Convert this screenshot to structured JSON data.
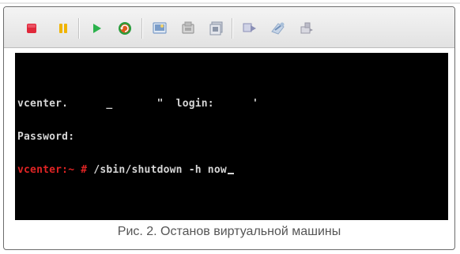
{
  "toolbar": {
    "buttons": [
      {
        "name": "power-off",
        "icon": "stop-square-icon",
        "color": "#e0283a"
      },
      {
        "name": "pause",
        "icon": "pause-icon",
        "color": "#f0b400"
      },
      {
        "name": "power-on",
        "icon": "play-icon",
        "color": "#2bb24c"
      },
      {
        "name": "reset",
        "icon": "reset-icon",
        "color": "#e05a1c"
      },
      {
        "name": "snapshot",
        "icon": "snapshot-icon",
        "color": "#7a9cc8"
      },
      {
        "name": "revert",
        "icon": "revert-icon",
        "color": "#9a9a9a"
      },
      {
        "name": "manager",
        "icon": "manager-icon",
        "color": "#8c96a8"
      },
      {
        "name": "fullscreen",
        "icon": "console-icon",
        "color": "#8a8fb6"
      },
      {
        "name": "tools",
        "icon": "tools-icon",
        "color": "#8fa8c8"
      },
      {
        "name": "settings",
        "icon": "devices-icon",
        "color": "#9a9aa8"
      }
    ]
  },
  "terminal": {
    "line1_host": "vcenter.",
    "line1_mid": "      _       \"  login:",
    "line1_tail": "      '",
    "line2": "Password:",
    "prompt": "vcenter:~ #",
    "command": " /sbin/shutdown -h now"
  },
  "colors": {
    "prompt": "#e02424",
    "text": "#d6d6d6",
    "screen_bg": "#000000"
  },
  "caption": "Рис. 2. Останов виртуальной машины"
}
